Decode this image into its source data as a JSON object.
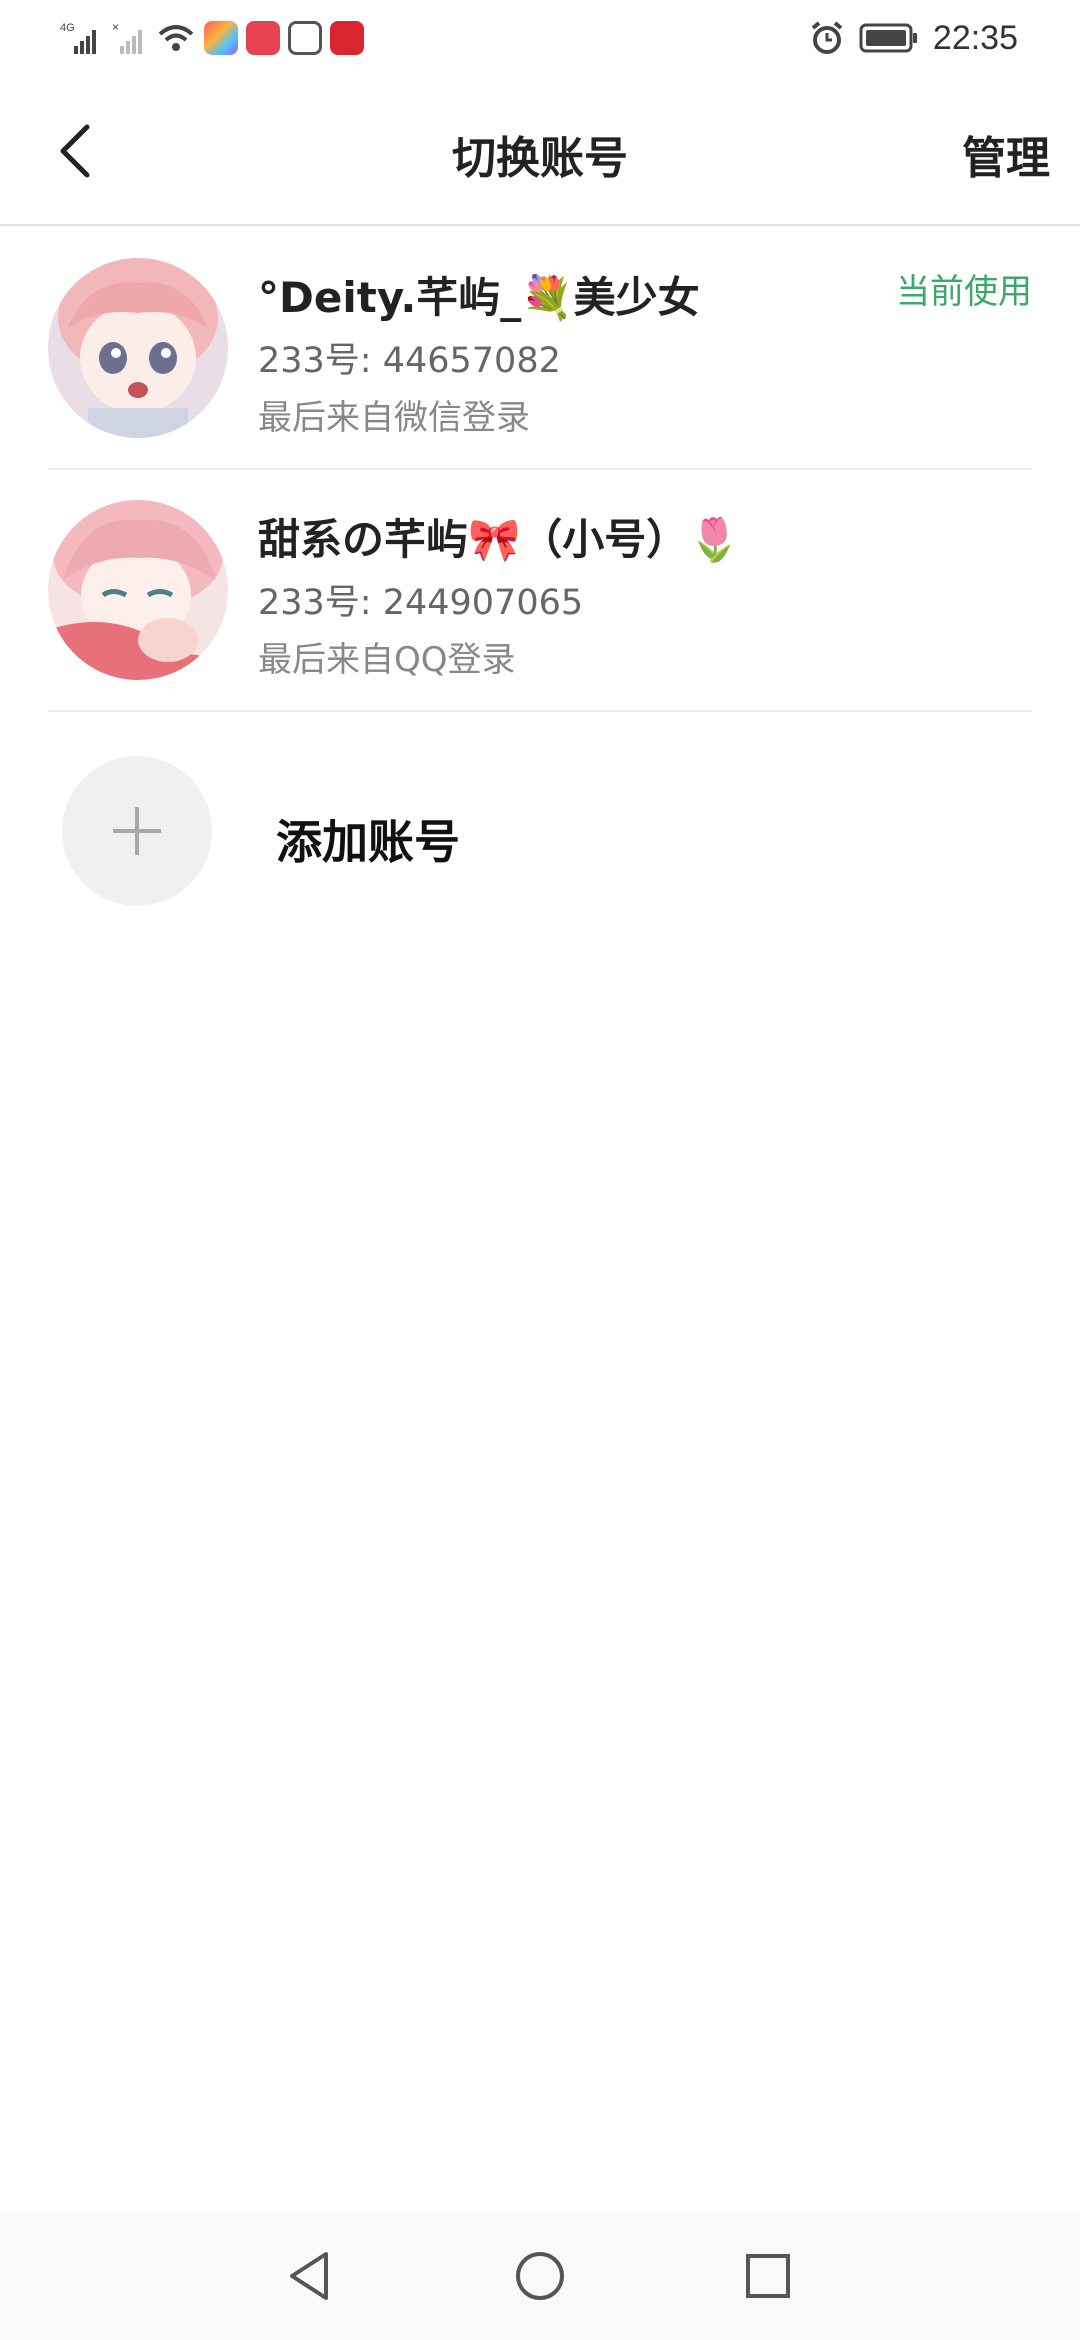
{
  "status_bar": {
    "network_label": "4G",
    "time": "22:35"
  },
  "header": {
    "title": "切换账号",
    "manage_label": "管理"
  },
  "accounts": [
    {
      "name": "°Deity.芊屿_💐美少女",
      "id_text": "233号: 44657082",
      "login_text": "最后来自微信登录",
      "status": "当前使用"
    },
    {
      "name": "甜系の芊屿🎀（小号）🌷",
      "id_text": "233号: 244907065",
      "login_text": "最后来自QQ登录"
    }
  ],
  "add_account": {
    "label": "添加账号"
  },
  "colors": {
    "accent_green": "#3aa86a",
    "divider": "#ececec"
  },
  "icons": {
    "back": "chevron-left-icon",
    "add": "plus-icon",
    "nav_back": "triangle-back-icon",
    "nav_home": "circle-home-icon",
    "nav_recent": "square-recent-icon"
  }
}
